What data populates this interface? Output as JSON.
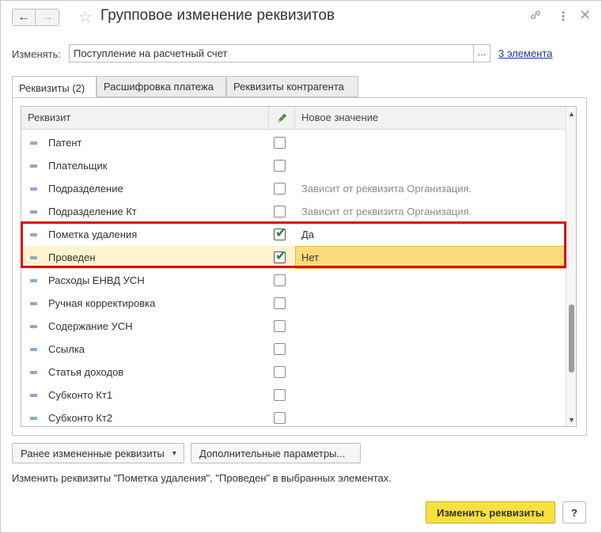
{
  "window": {
    "title": "Групповое изменение реквизитов",
    "back_icon": "←",
    "forward_icon": "→"
  },
  "change_field": {
    "label": "Изменять:",
    "value": "Поступление на расчетный счет",
    "select_button": "...",
    "elements_link": "3 элемента"
  },
  "tabs": [
    {
      "label": "Реквизиты (2)",
      "active": true
    },
    {
      "label": "Расшифровка платежа",
      "active": false
    },
    {
      "label": "Реквизиты контрагента",
      "active": false
    }
  ],
  "grid": {
    "columns": {
      "rekvizit": "Реквизит",
      "new_value": "Новое значение"
    },
    "rows": [
      {
        "name": "Патент",
        "checked": false,
        "value": ""
      },
      {
        "name": "Плательщик",
        "checked": false,
        "value": ""
      },
      {
        "name": "Подразделение",
        "checked": false,
        "value": "Зависит от реквизита Организация."
      },
      {
        "name": "Подразделение Кт",
        "checked": false,
        "value": "Зависит от реквизита Организация."
      },
      {
        "name": "Пометка удаления",
        "checked": true,
        "value": "Да"
      },
      {
        "name": "Проведен",
        "checked": true,
        "value": "Нет"
      },
      {
        "name": "Расходы ЕНВД УСН",
        "checked": false,
        "value": ""
      },
      {
        "name": "Ручная корректировка",
        "checked": false,
        "value": ""
      },
      {
        "name": "Содержание УСН",
        "checked": false,
        "value": ""
      },
      {
        "name": "Ссылка",
        "checked": false,
        "value": ""
      },
      {
        "name": "Статья доходов",
        "checked": false,
        "value": ""
      },
      {
        "name": "Субконто Кт1",
        "checked": false,
        "value": ""
      },
      {
        "name": "Субконто Кт2",
        "checked": false,
        "value": ""
      }
    ]
  },
  "buttons": {
    "previous": "Ранее измененные реквизиты",
    "extra_params": "Дополнительные параметры...",
    "apply": "Изменить реквизиты",
    "help": "?"
  },
  "hint": "Изменить реквизиты \"Пометка удаления\", \"Проведен\" в выбранных элементах.",
  "colors": {
    "accent_button": "#f8e040",
    "selected_row": "#fdf3cf",
    "highlight_frame": "#d40e0e",
    "check_mark": "#1f8a3a"
  }
}
